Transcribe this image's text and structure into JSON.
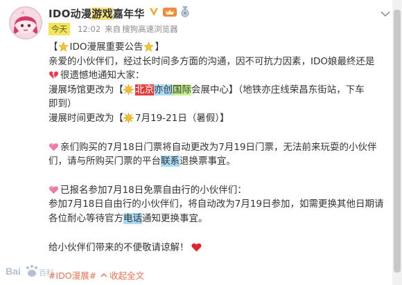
{
  "post": {
    "username_parts": [
      "IDO动漫",
      "游戏",
      "嘉年华"
    ],
    "today_tag": "今天",
    "time": "12:02",
    "source_prefix": "来自",
    "source": "搜狗高速浏览器",
    "title_text": "IDO漫展重要公告",
    "line1": "亲爱的小伙伴们，经过长时间多方面的沟通，因不可抗力因素，IDO娘最终还是",
    "line2": "很遗憾地通知大家：",
    "venue_prefix": "漫展场馆更改为【",
    "venue_beijing": "北京",
    "venue_yi": "亦创",
    "venue_guoji": "国际",
    "venue_suffix": "会展中心】（地铁亦庄线荣昌东街站，下车",
    "venue_cont": "即到）",
    "time_prefix": "漫展时间更改为【",
    "time_value": "7月19-21日（暑假）",
    "time_suffix": "】",
    "p2_line1": "亲们购买的7月18日门票将自动更改为7月19日门票，无法前来玩耍的小伙伴",
    "p2_line2a": "们，请与所购买门票的平台",
    "p2_lianxi": "联系",
    "p2_line2b": "退换票事宜。",
    "p3_head": "已报名参加7月18日免票自由行的小伙伴们：",
    "p3_line1": "参加7月18日自由行的小伙伴们，将自动改为7月19日参加，如需更换其他日期请",
    "p3_line2a": "各位耐心等待官方",
    "p3_dianhua": "电话",
    "p3_line2b": "通知更换事宜。",
    "closing": "给小伙伴们带来的不便敬请谅解！",
    "hashtag": "#IDO漫展#",
    "collapse": "收起全文",
    "watermark_text": "Bai百科"
  },
  "icons": [
    "verified-v-icon",
    "vip-crown-icon",
    "medal-icon",
    "chevron-down-icon",
    "star-emoji-icon",
    "broken-heart-emoji-icon",
    "burst-emoji-icon",
    "heart-emoji-icon",
    "red-heart-emoji-icon"
  ],
  "colors": {
    "link": "#eb7350",
    "today_tag": "#f5e35d",
    "highlight_red": "#e33b3b",
    "highlight_blue": "#a8daf5",
    "highlight_green": "#c6f28a"
  }
}
